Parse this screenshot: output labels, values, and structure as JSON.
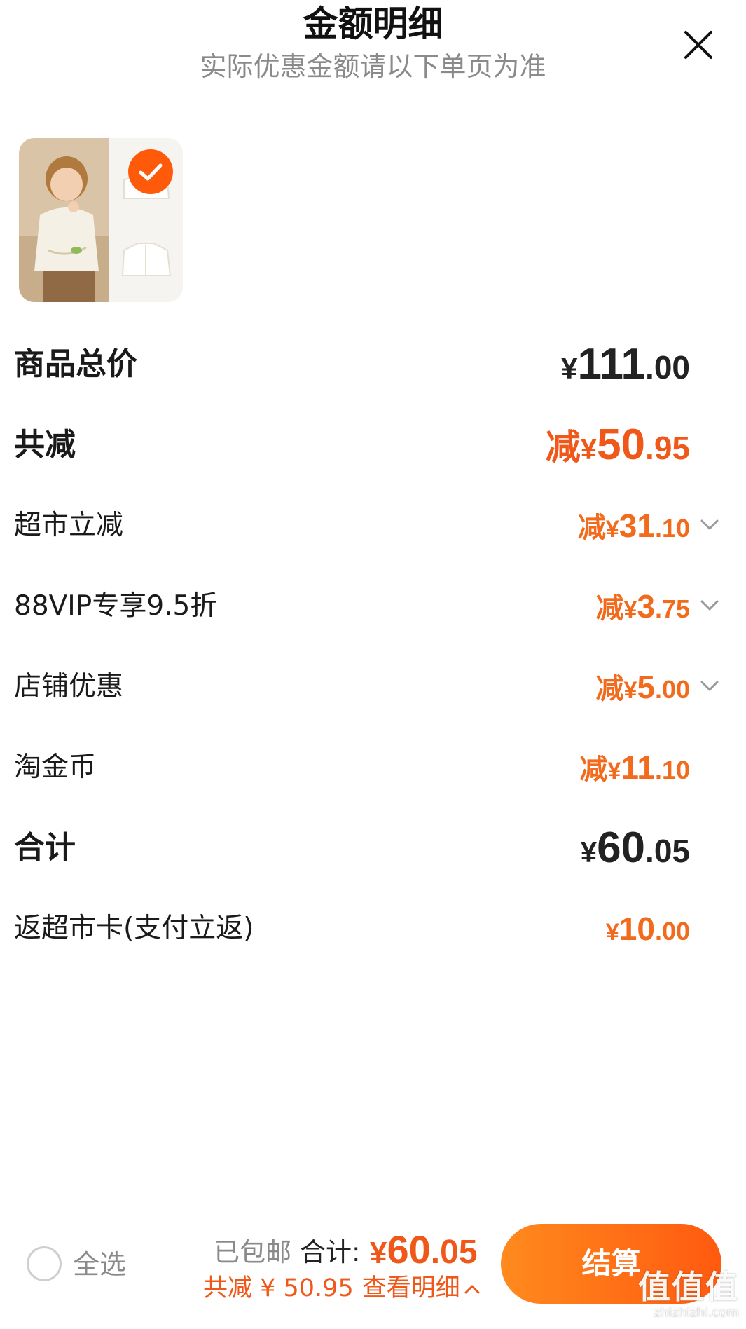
{
  "header": {
    "title": "金额明细",
    "subtitle": "实际优惠金额请以下单页为准"
  },
  "icons": {
    "close": "close-icon",
    "check": "check-icon",
    "chevron": "chevron-down-icon"
  },
  "rows": {
    "total_price": {
      "label": "商品总价",
      "yen": "¥",
      "int": "111",
      "dec": ".00"
    },
    "total_discount": {
      "label": "共减",
      "prefix": "减",
      "yen": "¥",
      "int": "50",
      "dec": ".95"
    },
    "supermarket": {
      "label": "超市立减",
      "prefix": "减",
      "yen": "¥",
      "int": "31",
      "dec": ".10"
    },
    "vip": {
      "label": "88VIP专享9.5折",
      "prefix": "减",
      "yen": "¥",
      "int": "3",
      "dec": ".75"
    },
    "shop": {
      "label": "店铺优惠",
      "prefix": "减",
      "yen": "¥",
      "int": "5",
      "dec": ".00"
    },
    "coin": {
      "label": "淘金币",
      "prefix": "减",
      "yen": "¥",
      "int": "11",
      "dec": ".10"
    },
    "sum": {
      "label": "合计",
      "yen": "¥",
      "int": "60",
      "dec": ".05"
    },
    "card": {
      "label": "返超市卡(支付立返)",
      "yen": "¥",
      "int": "10",
      "dec": ".00"
    }
  },
  "bottom": {
    "select_all": "全选",
    "shipping": "已包邮",
    "total_label": "合计:",
    "total_yen": "¥",
    "total_int": "60",
    "total_dec": ".05",
    "saved": "共减 ¥ 50.95",
    "view_detail": "查看明细",
    "checkout": "结算"
  },
  "watermark": {
    "text": "值值值",
    "url": "zhizhizhi.com"
  },
  "colors": {
    "accent": "#f0581a",
    "checkout_start": "#ff8a1e",
    "checkout_end": "#ff5a0f",
    "text": "#1a1a1a",
    "muted": "#8a8a8a"
  }
}
